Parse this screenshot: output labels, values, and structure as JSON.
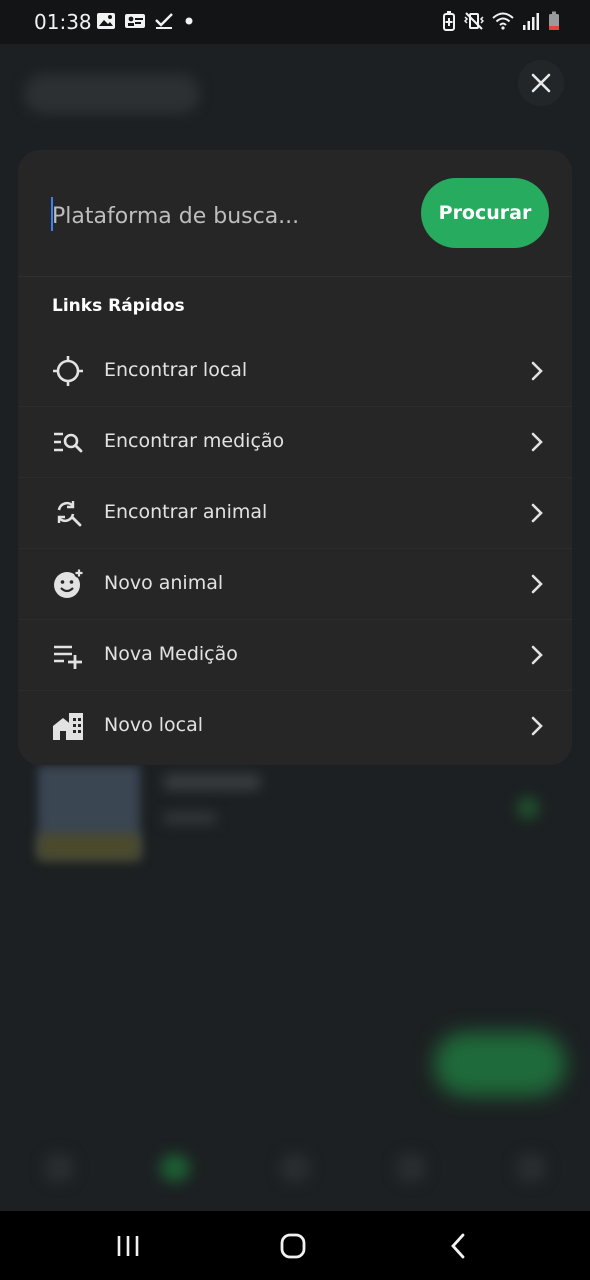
{
  "status_bar": {
    "time": "01:38",
    "icons_left": [
      "image-icon",
      "contact-card-icon",
      "check-icon",
      "dot-icon"
    ],
    "icons_right": [
      "battery-saver-icon",
      "vibrate-mute-icon",
      "wifi-icon",
      "signal-icon",
      "battery-low-icon"
    ]
  },
  "search": {
    "placeholder": "Plataforma de busca...",
    "button_label": "Procurar"
  },
  "quick_links": {
    "title": "Links Rápidos",
    "items": [
      {
        "label": "Encontrar local",
        "icon": "crosshair-icon"
      },
      {
        "label": "Encontrar medição",
        "icon": "list-search-icon"
      },
      {
        "label": "Encontrar animal",
        "icon": "search-refresh-icon"
      },
      {
        "label": "Novo animal",
        "icon": "face-plus-icon"
      },
      {
        "label": "Nova Medição",
        "icon": "list-plus-icon"
      },
      {
        "label": "Novo local",
        "icon": "building-icon"
      }
    ]
  },
  "colors": {
    "accent": "#27ab5e",
    "modal_bg": "#262626",
    "page_bg": "#1b1e20"
  }
}
